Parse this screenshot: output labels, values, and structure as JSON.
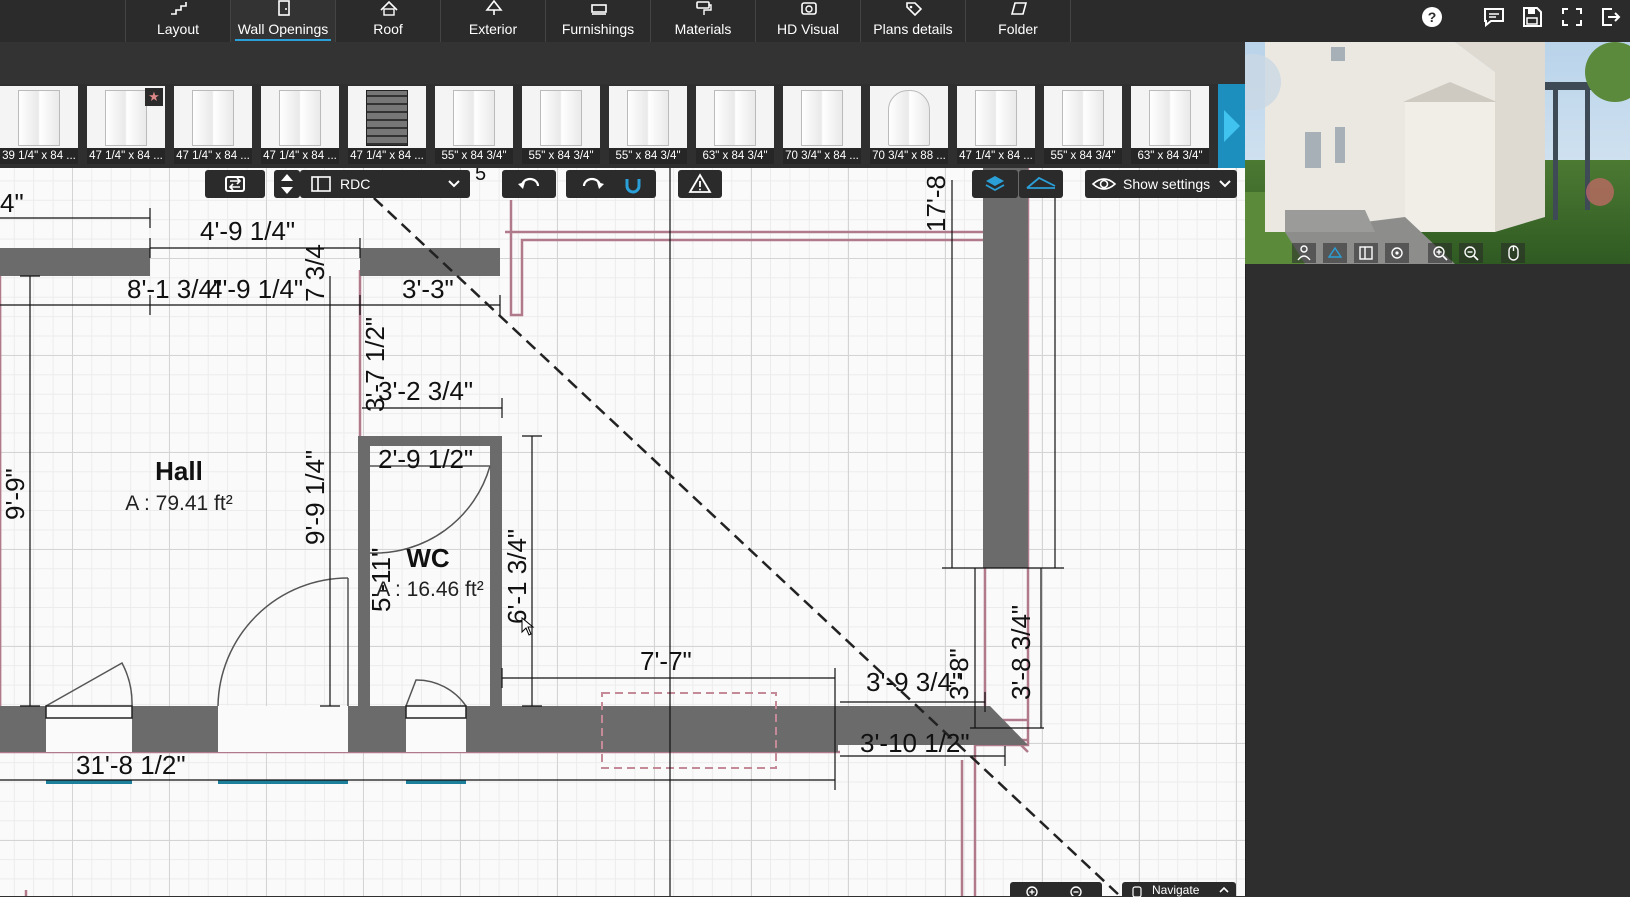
{
  "tabs": [
    {
      "label": "Layout",
      "icon": "stairs-icon",
      "active": false
    },
    {
      "label": "Wall Openings",
      "icon": "door-icon",
      "active": true
    },
    {
      "label": "Roof",
      "icon": "roof-icon",
      "active": false
    },
    {
      "label": "Exterior",
      "icon": "tree-icon",
      "active": false
    },
    {
      "label": "Furnishings",
      "icon": "sofa-icon",
      "active": false
    },
    {
      "label": "Materials",
      "icon": "paint-roller-icon",
      "active": false
    },
    {
      "label": "HD Visual",
      "icon": "camera-icon",
      "active": false
    },
    {
      "label": "Plans details",
      "icon": "tags-icon",
      "active": false
    },
    {
      "label": "Folder",
      "icon": "folder-icon",
      "active": false
    }
  ],
  "top_icons": [
    "help-icon",
    "chat-icon",
    "save-icon",
    "fullscreen-icon",
    "exit-icon"
  ],
  "catalog": [
    {
      "label": "39 1/4\" x 84 ...",
      "style": "double"
    },
    {
      "label": "47 1/4\" x 84 ...",
      "style": "double",
      "favorite": true
    },
    {
      "label": "47 1/4\" x 84 ...",
      "style": "double"
    },
    {
      "label": "47 1/4\" x 84 ...",
      "style": "double"
    },
    {
      "label": "47 1/4\" x 84 ...",
      "style": "dark"
    },
    {
      "label": "55\" x 84 3/4\"",
      "style": "double"
    },
    {
      "label": "55\" x 84 3/4\"",
      "style": "double"
    },
    {
      "label": "55\" x 84 3/4\"",
      "style": "double"
    },
    {
      "label": "63\" x 84 3/4\"",
      "style": "double"
    },
    {
      "label": "70 3/4\" x 84 ...",
      "style": "double"
    },
    {
      "label": "70 3/4\" x 88 ...",
      "style": "arch"
    },
    {
      "label": "47 1/4\" x 84 ...",
      "style": "double"
    },
    {
      "label": "55\" x 84 3/4\"",
      "style": "double"
    },
    {
      "label": "63\" x 84 3/4\"",
      "style": "double"
    }
  ],
  "favorite_mark": "★",
  "toolbar": {
    "level": "RDC",
    "show_settings": "Show settings"
  },
  "rooms": {
    "hall_name": "Hall",
    "hall_area": "A : 79.41 ft²",
    "wc_name": "WC",
    "wc_area": "A : 16.46 ft²"
  },
  "dimensions": {
    "d_top_left": "4\"",
    "d_4_9_top": "4'-9 1/4\"",
    "d_8_1": "8'-1 3/4\"",
    "d_4_9_b": "4'-9 1/4\"",
    "d_3_3": "3'-3\"",
    "d_7_3_4": "7 3/4",
    "d_3_7_half": "3'-7 1/2\"",
    "d_3_2": "3'-2 3/4\"",
    "d_2_9": "2'-9 1/2\"",
    "d_9_9": "9'-9\"",
    "d_9_9_quarter": "9'-9 1/4\"",
    "d_5_11": "5'-11\"",
    "d_6_1": "6'-1 3/4\"",
    "d_7_7": "7'-7\"",
    "d_3_9": "3'-9 3/4\"",
    "d_3_10": "3'-10 1/2\"",
    "d_3_8": "3'-8\"",
    "d_3_8_3_4": "3'-8 3/4\"",
    "d_31_8": "31'-8 1/2\"",
    "d_17_8": "17'-8",
    "d_top_small": "5"
  },
  "bottom": {
    "navigate": "Navigate"
  },
  "colors": {
    "accent": "#2a9fd8",
    "wall": "#6b6b6b",
    "wall_outline": "#b07a8a",
    "opening_marker": "#1e7f9a"
  }
}
